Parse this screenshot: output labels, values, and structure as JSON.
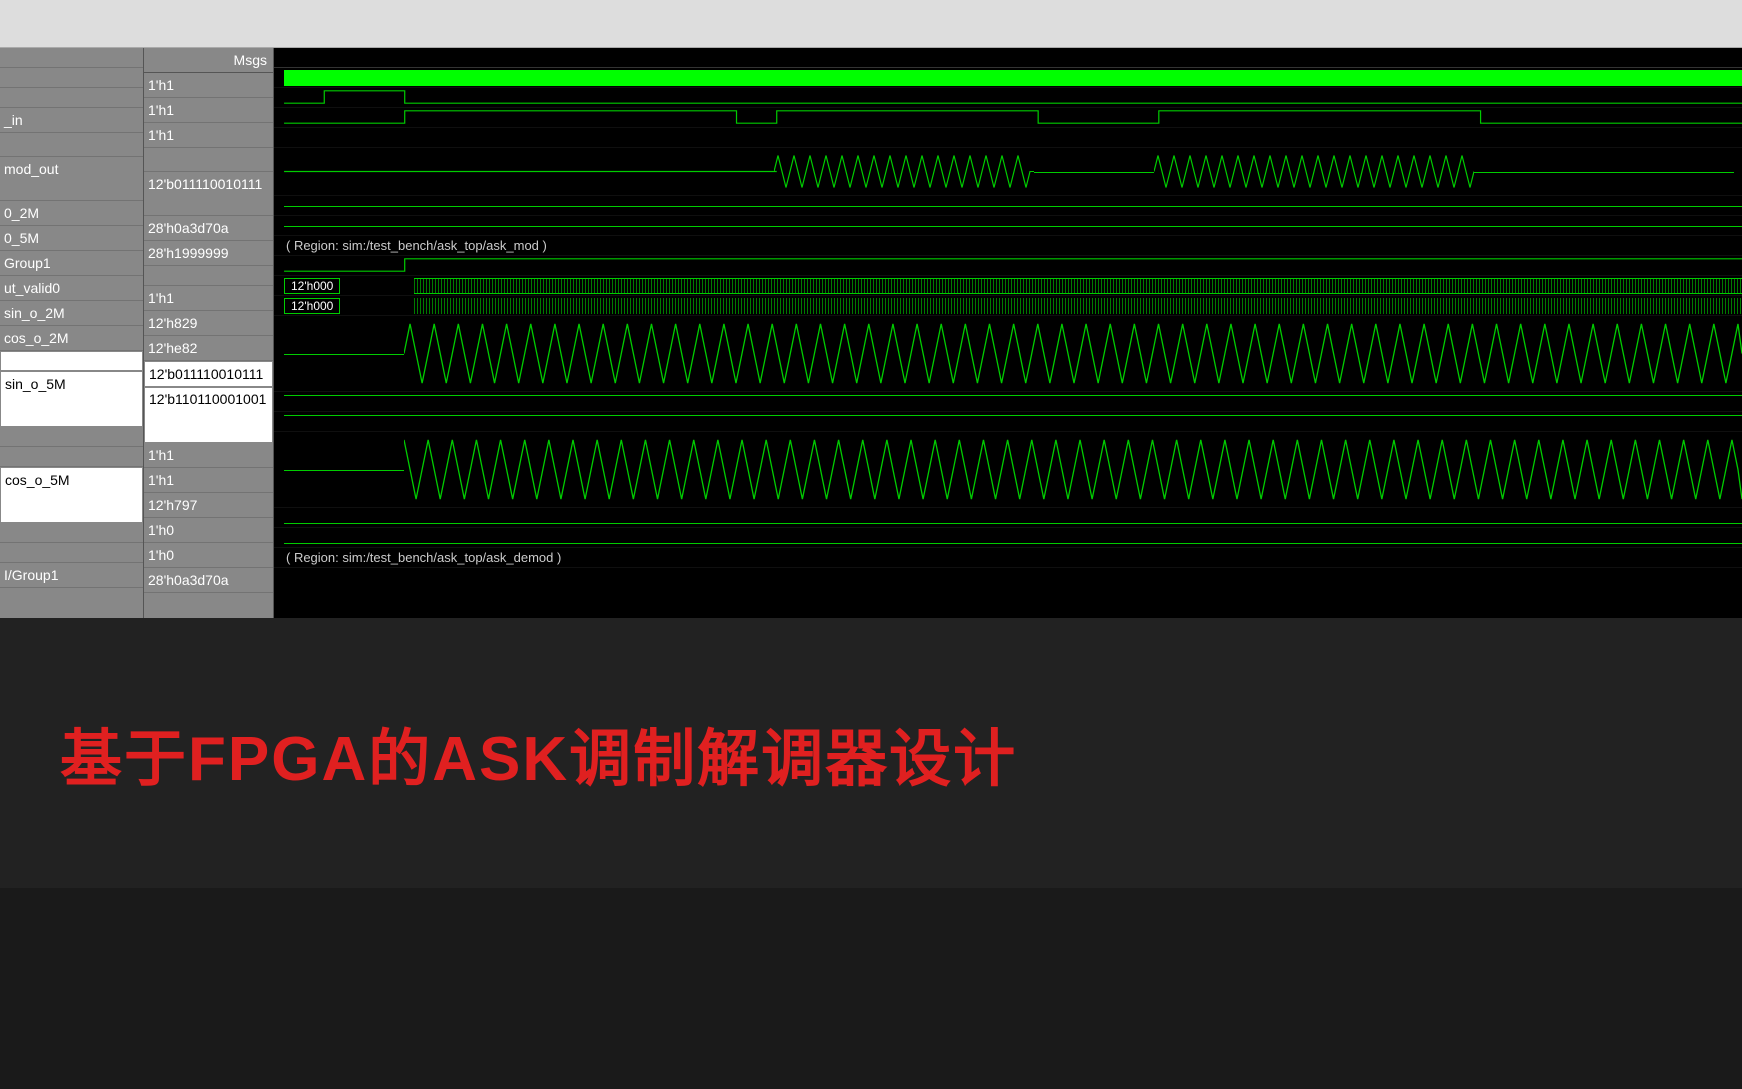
{
  "msgs_header": "Msgs",
  "signals": {
    "names": [
      "",
      "",
      "_in",
      "",
      "mod_out",
      "",
      "0_2M",
      "0_5M",
      "Group1",
      "ut_valid0",
      "sin_o_2M",
      "cos_o_2M",
      "",
      "sin_o_5M",
      "",
      "",
      "",
      "",
      "cos_o_5M",
      "",
      "",
      "I/Group1"
    ],
    "values": [
      "1'h1",
      "1'h1",
      "1'h1",
      "",
      "12'b011110010111",
      "",
      "28'h0a3d70a",
      "28'h1999999",
      "",
      "1'h1",
      "12'h829",
      "12'he82",
      "12'b011110010111",
      "12'b110110001001",
      "",
      "1'h1",
      "1'h1",
      "12'h797",
      "1'h0",
      "1'h0",
      "28'h0a3d70a",
      ""
    ]
  },
  "region_labels": {
    "mod": "( Region: sim:/test_bench/ask_top/ask_mod )",
    "demod": "( Region: sim:/test_bench/ask_top/ask_demod )"
  },
  "bus_labels": {
    "b1": "12'h000",
    "b2": "12'h000"
  },
  "title": "基于FPGA的ASK调制解调器设计"
}
